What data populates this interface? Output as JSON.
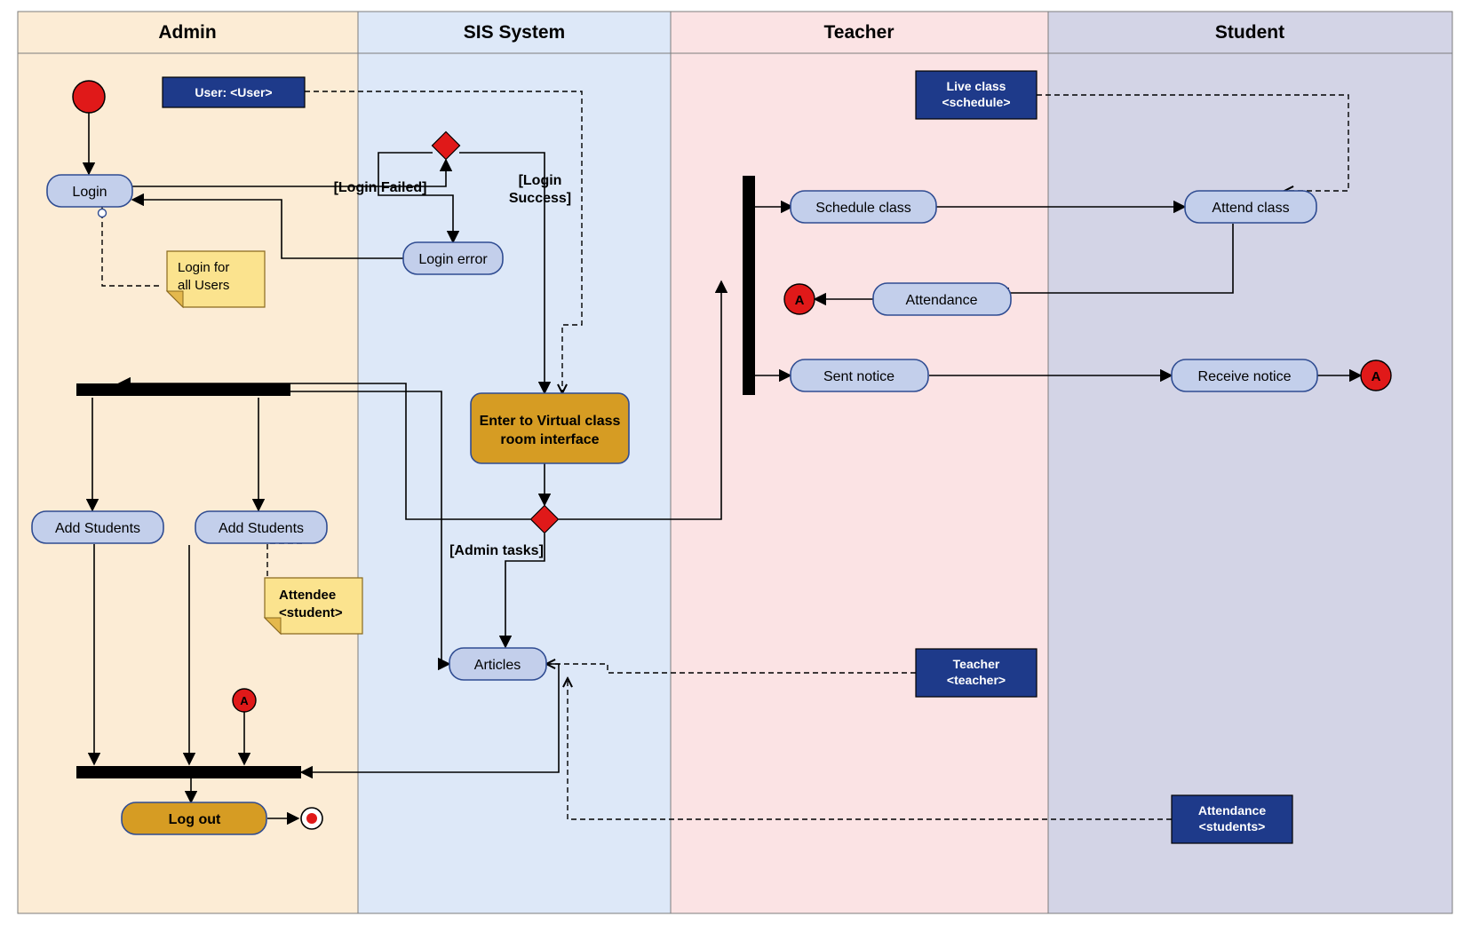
{
  "swimlanes": {
    "admin": "Admin",
    "sis": "SIS System",
    "teacher": "Teacher",
    "student": "Student"
  },
  "activities": {
    "login": "Login",
    "loginError": "Login error",
    "enterVC_l1": "Enter to Virtual class",
    "enterVC_l2": "room interface",
    "addStudents1": "Add Students",
    "addStudents2": "Add Students",
    "articles": "Articles",
    "logout": "Log out",
    "scheduleClass": "Schedule class",
    "attendance": "Attendance",
    "sentNotice": "Sent notice",
    "attendClass": "Attend class",
    "receiveNotice": "Receive notice"
  },
  "guards": {
    "loginFailed": "[Login Failed]",
    "loginSuccess_l1": "[Login",
    "loginSuccess_l2": "Success]",
    "adminTasks": "[Admin tasks]"
  },
  "io": {
    "user": "User: <User>",
    "liveClass_l1": "Live class",
    "liveClass_l2": "<schedule>",
    "teacher_l1": "Teacher",
    "teacher_l2": "<teacher>",
    "attendance_l1": "Attendance",
    "attendance_l2": "<students>"
  },
  "notes": {
    "loginFor_l1": "Login for",
    "loginFor_l2": "all Users",
    "attendee_l1": "Attendee",
    "attendee_l2": "<student>"
  },
  "connectors": {
    "a": "A"
  },
  "colors": {
    "laneAdmin": "#FCECD5",
    "laneSis": "#DDE8F8",
    "laneTeacher": "#FBE3E4",
    "laneStudent": "#D3D4E6",
    "laneBorder": "#7D7D7D",
    "activityFill": "#C3CFEB",
    "activityStroke": "#2F4C92",
    "accentFill": "#D69C23",
    "ioFill": "#1E3A8A",
    "noteFill": "#FBE38E",
    "noteDark": "#E4B84D",
    "decision": "#E01919",
    "forkBar": "#000000"
  }
}
